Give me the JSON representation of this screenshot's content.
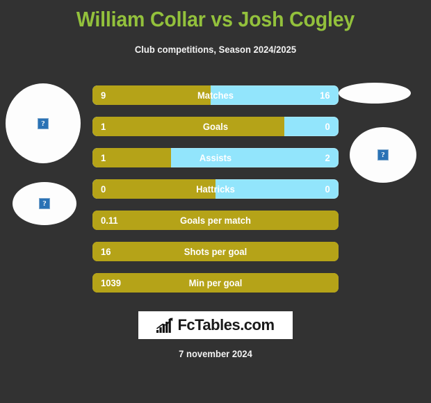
{
  "header": {
    "title": "William Collar vs Josh Cogley",
    "subtitle": "Club competitions, Season 2024/2025",
    "title_color": "#93c13c"
  },
  "theme": {
    "background": "#323232",
    "home_color": "#b5a318",
    "away_color": "#92e5fc",
    "text_color": "#ffffff"
  },
  "photos": [
    {
      "name": "home-player-photo",
      "alt": "?"
    },
    {
      "name": "home-club-logo",
      "alt": "?"
    },
    {
      "name": "away-club-logo",
      "alt": ""
    },
    {
      "name": "away-player-photo",
      "alt": "?"
    }
  ],
  "stats": [
    {
      "label": "Matches",
      "home": "9",
      "away": "16",
      "home_pct": 48,
      "dual": true
    },
    {
      "label": "Goals",
      "home": "1",
      "away": "0",
      "home_pct": 78,
      "dual": true
    },
    {
      "label": "Assists",
      "home": "1",
      "away": "2",
      "home_pct": 32,
      "dual": true
    },
    {
      "label": "Hattricks",
      "home": "0",
      "away": "0",
      "home_pct": 50,
      "dual": true
    },
    {
      "label": "Goals per match",
      "home": "0.11",
      "away": "",
      "home_pct": 100,
      "dual": false
    },
    {
      "label": "Shots per goal",
      "home": "16",
      "away": "",
      "home_pct": 100,
      "dual": false
    },
    {
      "label": "Min per goal",
      "home": "1039",
      "away": "",
      "home_pct": 100,
      "dual": false
    }
  ],
  "footer": {
    "logo_text": "FcTables.com",
    "logo_icon": "bar-chart-growth-icon",
    "date": "7 november 2024"
  }
}
